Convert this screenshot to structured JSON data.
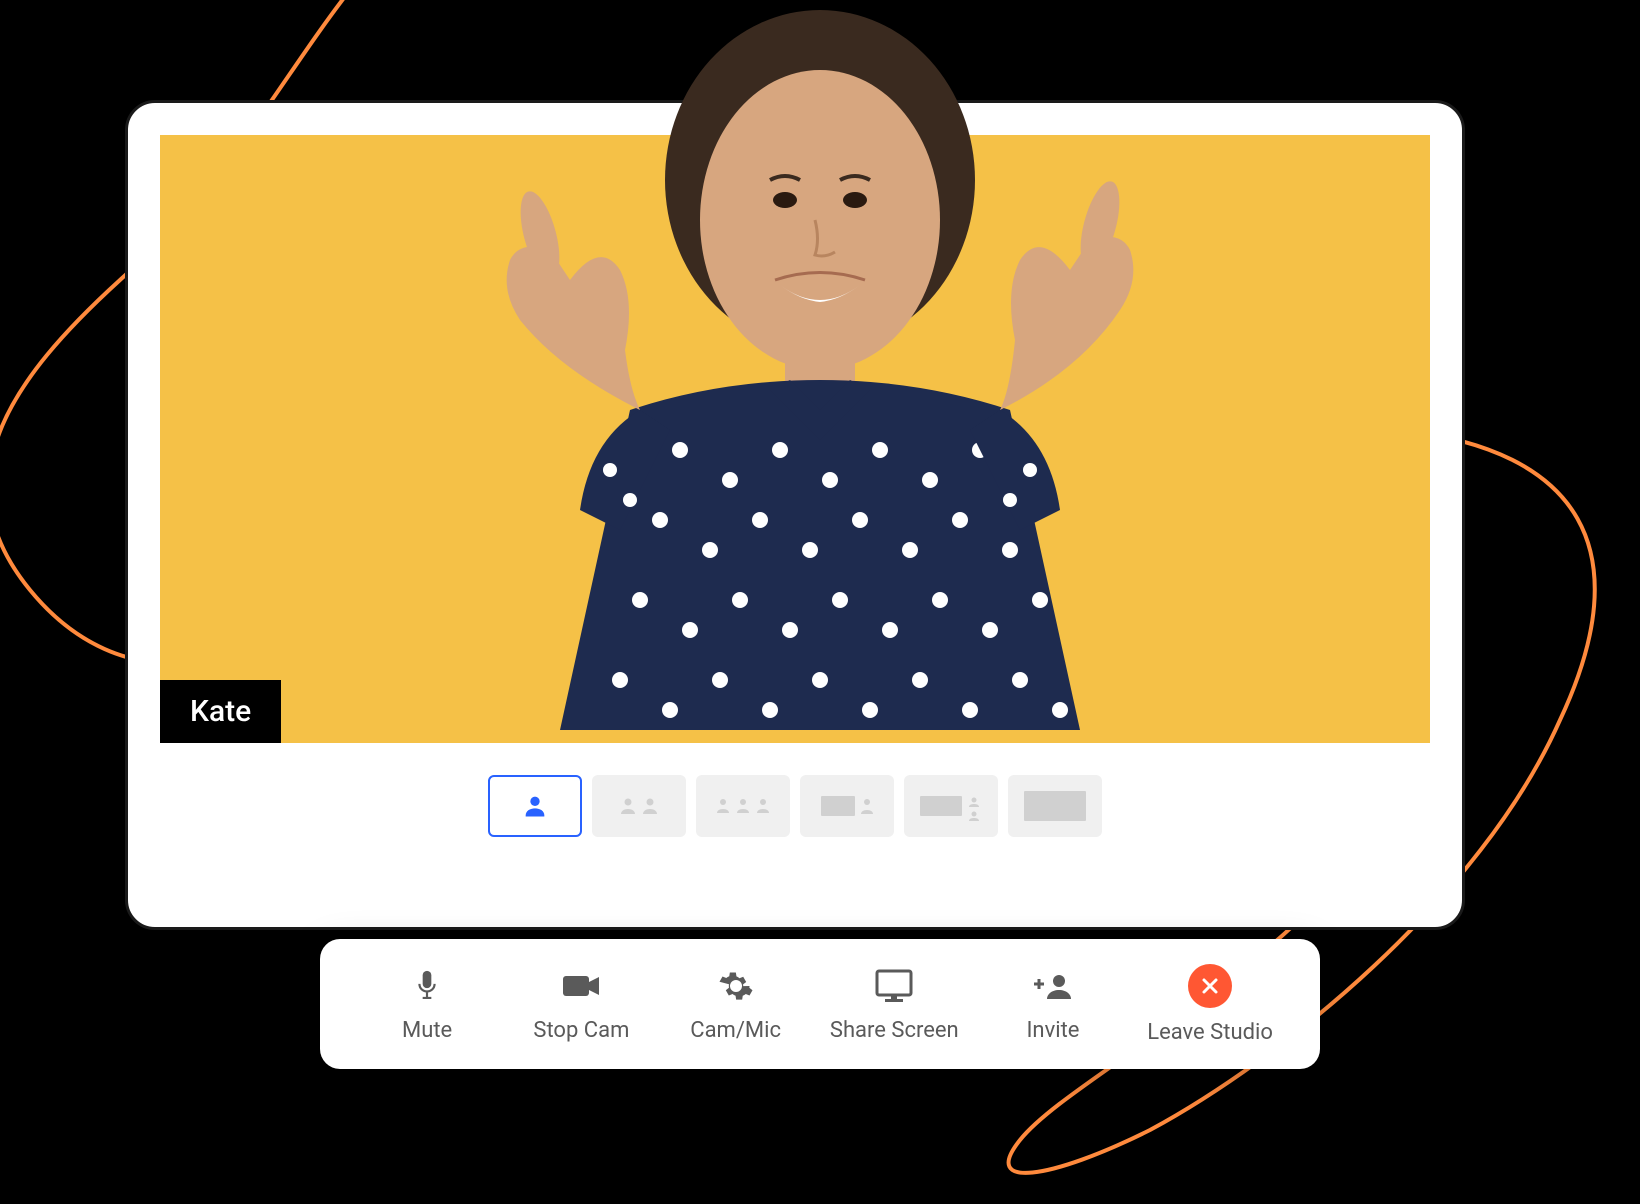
{
  "participant": {
    "name": "Kate"
  },
  "colors": {
    "video_bg": "#f5c147",
    "accent": "#2962ff",
    "leave": "#ff5733",
    "decorative_line": "#ff8a3d"
  },
  "layouts": {
    "active_index": 0,
    "items": [
      {
        "type": "single"
      },
      {
        "type": "two"
      },
      {
        "type": "three"
      },
      {
        "type": "screen-one"
      },
      {
        "type": "screen-two"
      },
      {
        "type": "full"
      }
    ]
  },
  "controls": [
    {
      "id": "mute",
      "label": "Mute",
      "icon": "mic-icon"
    },
    {
      "id": "camera",
      "label": "Stop Cam",
      "icon": "camera-icon"
    },
    {
      "id": "settings",
      "label": "Cam/Mic",
      "icon": "gear-icon"
    },
    {
      "id": "share",
      "label": "Share Screen",
      "icon": "screen-icon"
    },
    {
      "id": "invite",
      "label": "Invite",
      "icon": "invite-icon"
    },
    {
      "id": "leave",
      "label": "Leave Studio",
      "icon": "close-icon"
    }
  ]
}
